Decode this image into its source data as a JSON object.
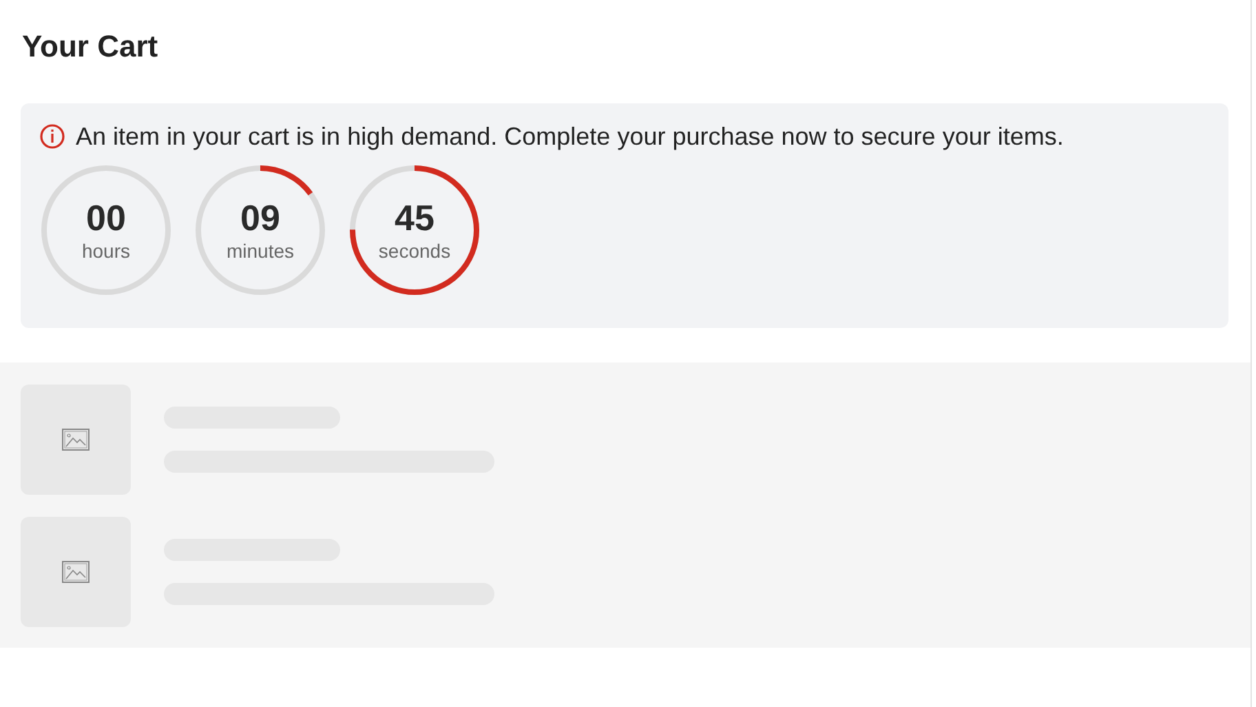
{
  "title": "Your Cart",
  "alert": {
    "message": "An item in your cart is in high demand. Complete your purchase now to secure your items.",
    "timers": [
      {
        "value": "00",
        "unit": "hours",
        "level": 0
      },
      {
        "value": "09",
        "unit": "minutes",
        "level": 0.15
      },
      {
        "value": "45",
        "unit": "seconds",
        "level": 0.75
      }
    ]
  },
  "cart_items": [
    {
      "kind": "skeleton"
    },
    {
      "kind": "skeleton"
    }
  ]
}
